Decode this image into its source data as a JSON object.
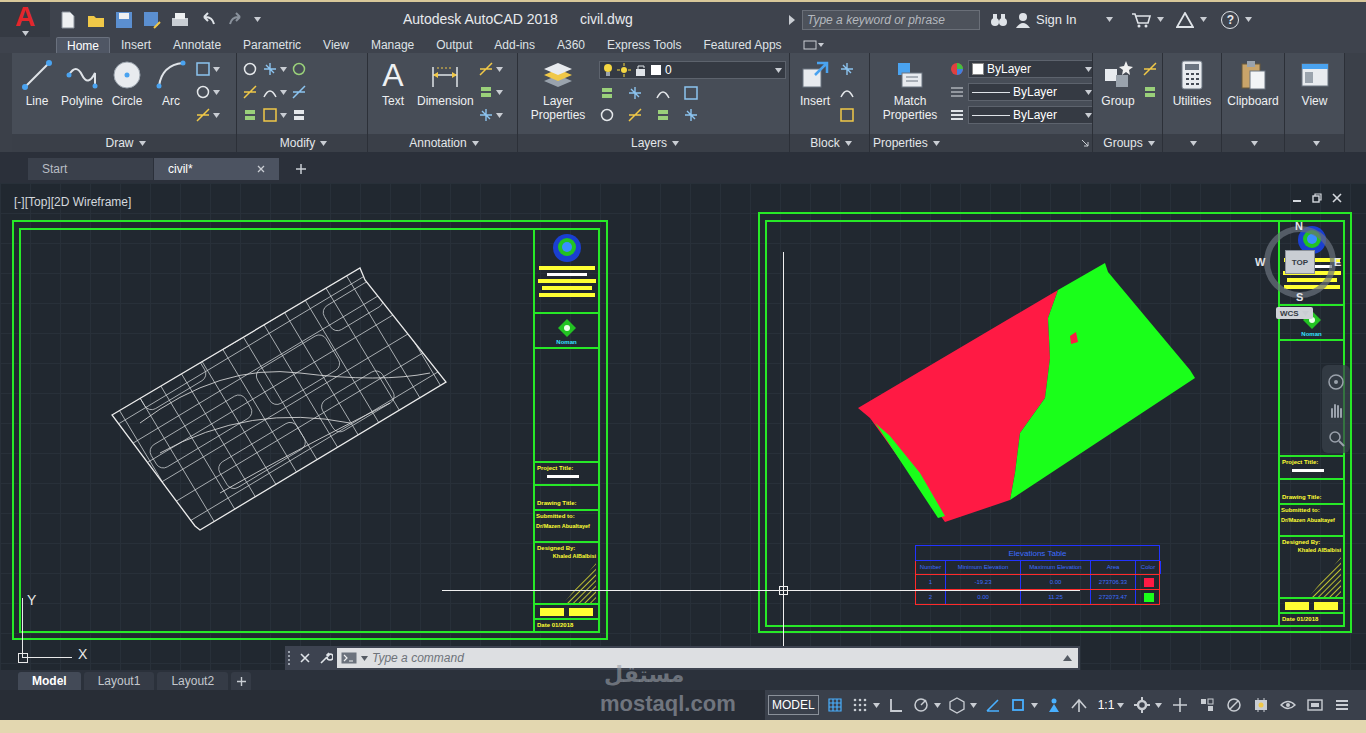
{
  "app": {
    "logo": "A",
    "title": "Autodesk AutoCAD 2018",
    "file": "civil.dwg",
    "search": {
      "placeholder": "Type a keyword or phrase"
    },
    "sign_in": "Sign In",
    "help": "?"
  },
  "ribbon_tabs": [
    {
      "label": "Home",
      "selected": true
    },
    {
      "label": "Insert",
      "selected": false
    },
    {
      "label": "Annotate",
      "selected": false
    },
    {
      "label": "Parametric",
      "selected": false
    },
    {
      "label": "View",
      "selected": false
    },
    {
      "label": "Manage",
      "selected": false
    },
    {
      "label": "Output",
      "selected": false
    },
    {
      "label": "Add-ins",
      "selected": false
    },
    {
      "label": "A360",
      "selected": false
    },
    {
      "label": "Express Tools",
      "selected": false
    },
    {
      "label": "Featured Apps",
      "selected": false
    }
  ],
  "ribbon_groups": [
    {
      "kind": "draw",
      "title": "Draw",
      "buttons": [
        "Line",
        "Polyline",
        "Circle",
        "Arc"
      ]
    },
    {
      "kind": "modify",
      "title": "Modify",
      "buttons": []
    },
    {
      "kind": "annotation",
      "title": "Annotation",
      "glyph": "A",
      "buttons": [
        "Text",
        "Dimension"
      ]
    },
    {
      "kind": "layers",
      "title": "Layers",
      "buttons": [
        "Layer Properties"
      ],
      "layer": "0"
    },
    {
      "kind": "block",
      "title": "Block",
      "buttons": [
        "Insert"
      ]
    },
    {
      "kind": "properties",
      "title": "Properties",
      "buttons": [
        "Match Properties"
      ],
      "values": [
        "ByLayer",
        "ByLayer",
        "ByLayer"
      ]
    },
    {
      "kind": "groups",
      "title": "Groups",
      "buttons": [
        "Group"
      ]
    },
    {
      "kind": "panel",
      "buttons": [
        "Utilities"
      ]
    },
    {
      "kind": "panel",
      "buttons": [
        "Clipboard"
      ]
    },
    {
      "kind": "panel",
      "buttons": [
        "View"
      ]
    }
  ],
  "file_tabs": [
    {
      "label": "Start",
      "selected": false
    },
    {
      "label": "civil*",
      "selected": true
    }
  ],
  "viewport": {
    "label": "[-][Top][2D Wireframe]"
  },
  "title_blocks": [
    {
      "logo_label": "Noman",
      "project_title": "Project Title:",
      "drawing_title": "Drawing Title:",
      "submitted_to": "Submitted to:",
      "supervisor": "Dr/Mazen Abualtayef",
      "designed_by": "Designed By:",
      "designer": "Khaled AlBalbisi",
      "date": "Date 01/2018"
    },
    {
      "logo_label": "Noman",
      "project_title": "Project Title:",
      "drawing_title": "Drawing Title:",
      "submitted_to": "Submitted to:",
      "supervisor": "Dr/Mazen Abualtayef",
      "designed_by": "Designed By:",
      "designer": "Khaled AlBalbisi",
      "date": "Date 01/2018"
    }
  ],
  "elevations_table": {
    "title": "Elevations Table",
    "columns": [
      "Number",
      "Minimum Elevation",
      "Maximum Elevation",
      "Area",
      "Color"
    ],
    "rows": [
      {
        "cells": [
          "1",
          "-19.23",
          "0.00",
          "273706.33"
        ],
        "color": "#ff1a44"
      },
      {
        "cells": [
          "2",
          "0.00",
          "11.25",
          "272073.47"
        ],
        "color": "#1aff1a"
      }
    ]
  },
  "viewcube": {
    "north": "N",
    "south": "S",
    "west": "W",
    "east": "E",
    "face": "TOP",
    "ucs": "WCS"
  },
  "ucs_icon": {
    "y": "Y",
    "x": "X"
  },
  "command_line": {
    "placeholder": "Type a command"
  },
  "layout_tabs": [
    {
      "label": "Model",
      "selected": true
    },
    {
      "label": "Layout1",
      "selected": false
    },
    {
      "label": "Layout2",
      "selected": false
    }
  ],
  "status_bar": {
    "mode": "MODEL",
    "toggles": [
      {
        "on": true
      },
      {
        "on": false
      },
      {
        "on": false
      },
      {
        "on": false
      },
      {
        "on": false
      },
      {
        "on": true
      },
      {
        "on": true
      },
      {
        "on": true
      },
      {
        "on": false
      }
    ],
    "scale": "1:1"
  },
  "watermark": {
    "logo": "مستقل",
    "text": "mostaql.com"
  }
}
